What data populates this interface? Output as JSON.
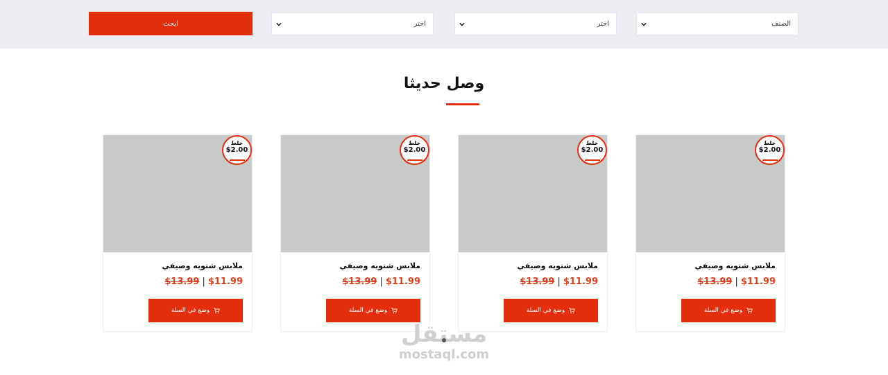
{
  "filters": {
    "search_label": "ابحث",
    "selects": [
      {
        "value": "اختر"
      },
      {
        "value": "اختر"
      },
      {
        "value": "الصنف"
      }
    ]
  },
  "section": {
    "title": "وصل حديثا"
  },
  "products": [
    {
      "name": "ملابس شتويه وصيفي",
      "price": "$11.99",
      "old_price": "$13.99",
      "badge_label": "خلط",
      "badge_amount": "$2.00",
      "cart_label": "وضع في السلة"
    },
    {
      "name": "ملابس شتويه وصيفي",
      "price": "$11.99",
      "old_price": "$13.99",
      "badge_label": "خلط",
      "badge_amount": "$2.00",
      "cart_label": "وضع في السلة"
    },
    {
      "name": "ملابس شتويه وصيفي",
      "price": "$11.99",
      "old_price": "$13.99",
      "badge_label": "خلط",
      "badge_amount": "$2.00",
      "cart_label": "وضع في السلة"
    },
    {
      "name": "ملابس شتويه وصيفي",
      "price": "$11.99",
      "old_price": "$13.99",
      "badge_label": "خلط",
      "badge_amount": "$2.00",
      "cart_label": "وضع في السلة"
    }
  ],
  "price_separator": "|",
  "watermark": {
    "arabic": "مستقل",
    "latin": "mostaql.com"
  },
  "colors": {
    "accent": "#e32e0c",
    "price": "#d8411f",
    "filter_bg": "#ecedf2",
    "image_placeholder": "#c9c9c9"
  },
  "icons": {
    "select": "chevron-down-icon",
    "cart": "cart-icon"
  }
}
